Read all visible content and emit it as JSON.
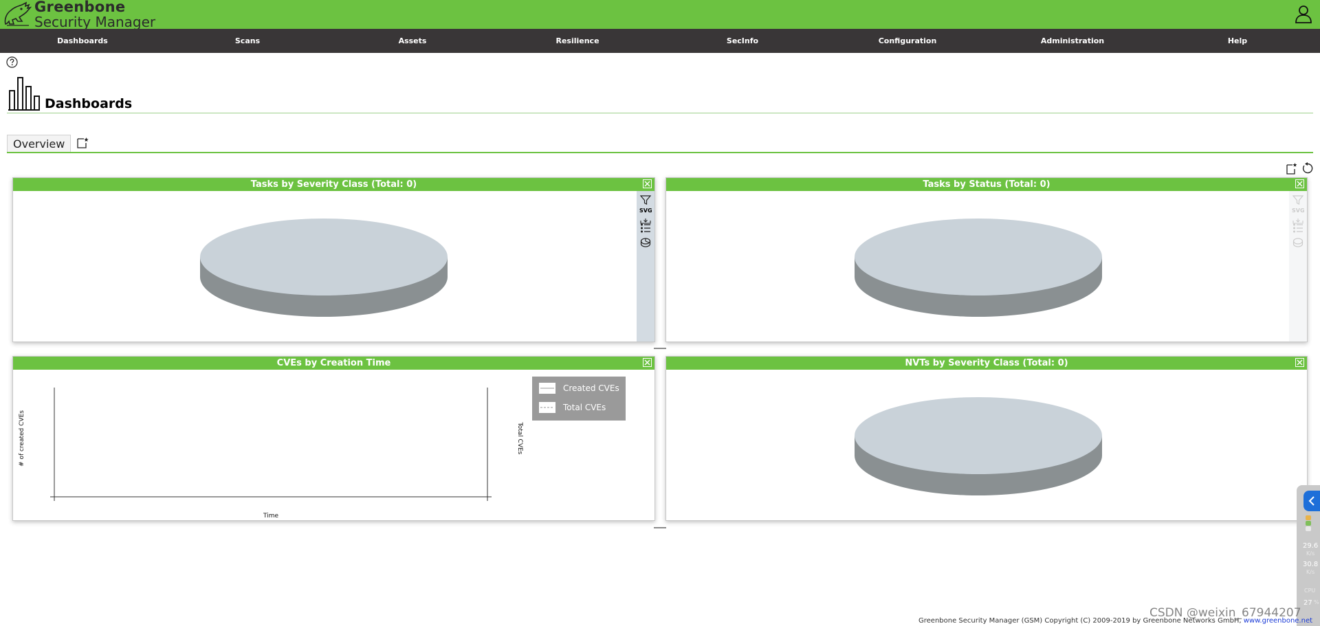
{
  "app": {
    "logo_line1": "Greenbone",
    "logo_line2": "Security Manager"
  },
  "menu": [
    {
      "label": "Dashboards"
    },
    {
      "label": "Scans"
    },
    {
      "label": "Assets"
    },
    {
      "label": "Resilience"
    },
    {
      "label": "SecInfo"
    },
    {
      "label": "Configuration"
    },
    {
      "label": "Administration"
    },
    {
      "label": "Help"
    }
  ],
  "page": {
    "title": "Dashboards"
  },
  "tabs": [
    {
      "label": "Overview",
      "selected": true
    }
  ],
  "panels": {
    "tasks_severity": {
      "title": "Tasks by Severity Class (Total: 0)"
    },
    "tasks_status": {
      "title": "Tasks by Status (Total: 0)"
    },
    "cves_creation": {
      "title": "CVEs by Creation Time",
      "xlabel": "Time",
      "ylabel_left": "# of created CVEs",
      "ylabel_right": "Total CVEs",
      "legend": [
        "Created CVEs",
        "Total CVEs"
      ]
    },
    "nvts_severity": {
      "title": "NVTs by Severity Class (Total: 0)"
    }
  },
  "side_tools": {
    "svg_label": "SVG"
  },
  "footer": {
    "text": "Greenbone Security Manager (GSM) Copyright (C) 2009-2019 by Greenbone Networks GmbH, ",
    "link": "www.greenbone.net"
  },
  "widget": {
    "up_value": "29.6",
    "up_unit": "K/s",
    "down_value": "30.8",
    "down_unit": "K/s",
    "cpu_label": "CPU",
    "cpu_value": "27",
    "cpu_unit": "%"
  },
  "watermark": "CSDN @weixin_67944207",
  "colors": {
    "brand_green": "#6cc241",
    "menu_bg": "#393637",
    "pie_top": "#c9d2d9",
    "pie_side": "#8a9092"
  }
}
